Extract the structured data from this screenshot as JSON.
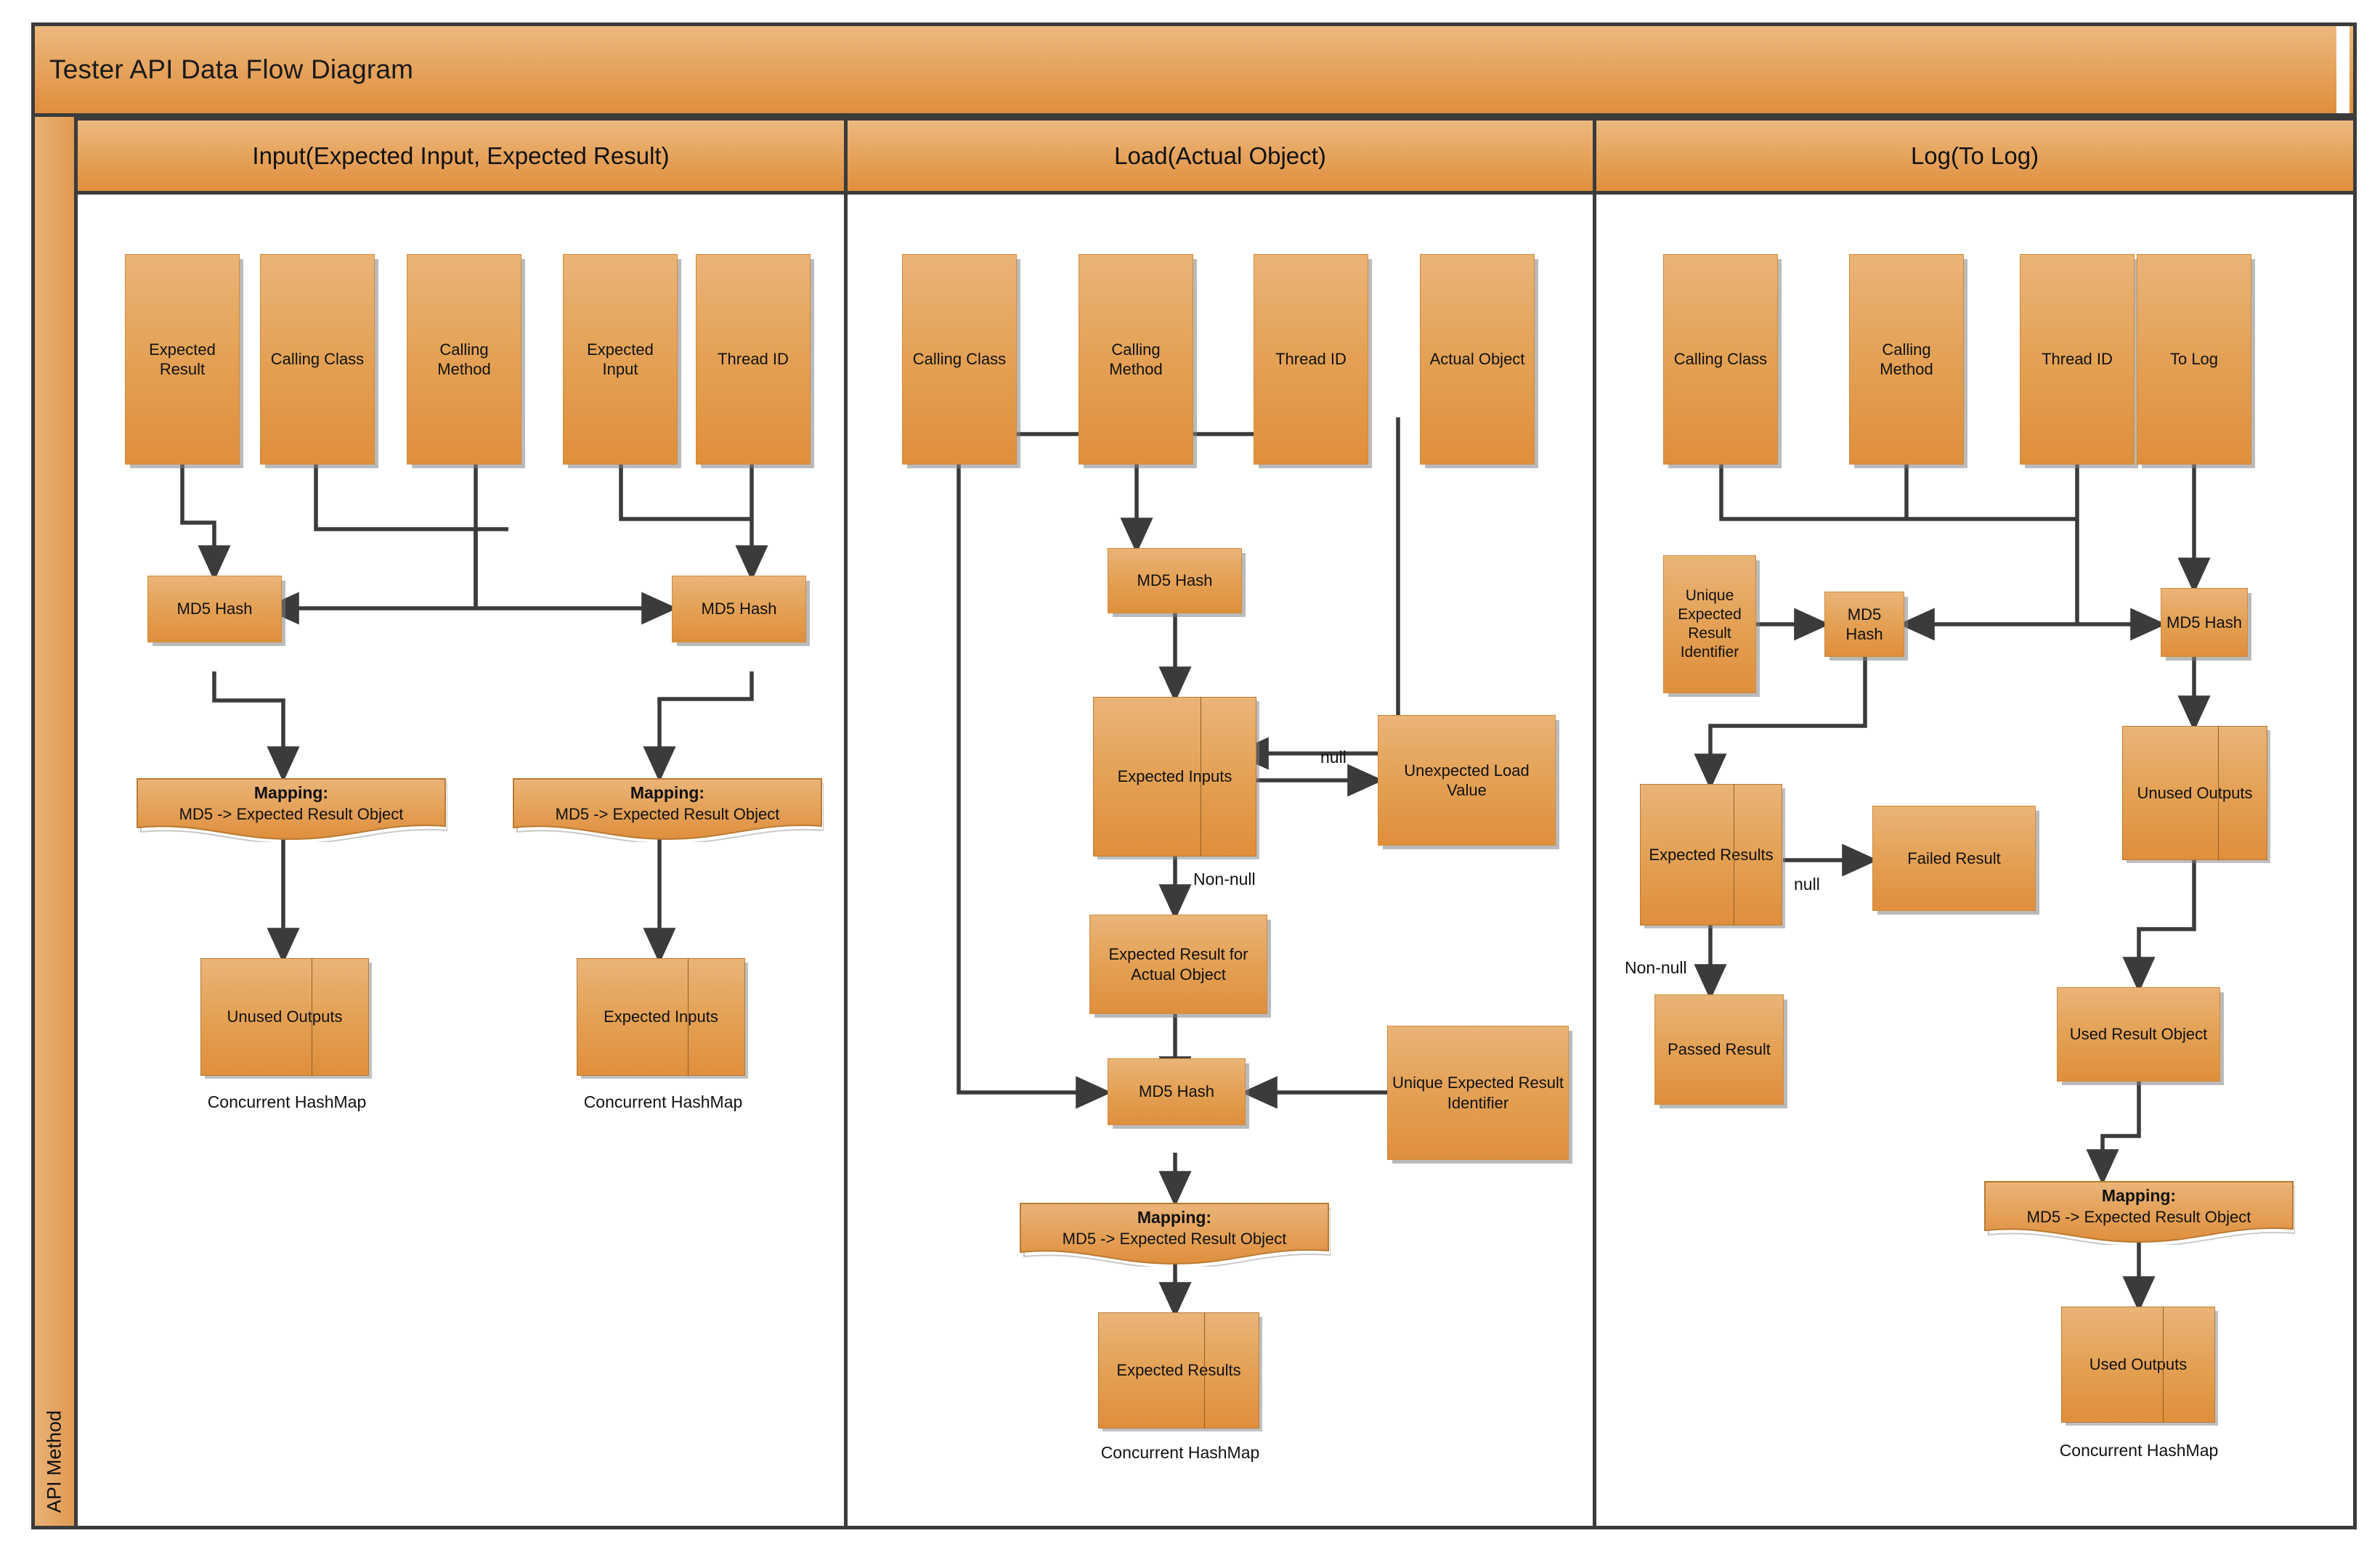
{
  "title": "Tester API Data Flow Diagram",
  "lane_label": "API Method",
  "columns": [
    {
      "header": "Input(Expected Input, Expected Result)",
      "inputs": [
        "Expected Result",
        "Calling Class",
        "Calling Method",
        "Expected Input",
        "Thread ID"
      ],
      "hash_left": "MD5 Hash",
      "hash_right": "MD5 Hash",
      "mapping_left": {
        "title": "Mapping:",
        "body": "MD5 -> Expected Result Object"
      },
      "mapping_right": {
        "title": "Mapping:",
        "body": "MD5 -> Expected Result Object"
      },
      "store_left": "Unused Outputs",
      "store_right": "Expected Inputs",
      "store_left_caption": "Concurrent HashMap",
      "store_right_caption": "Concurrent HashMap"
    },
    {
      "header": "Load(Actual Object)",
      "inputs": [
        "Calling Class",
        "Calling Method",
        "Thread ID",
        "Actual Object"
      ],
      "hash_top": "MD5 Hash",
      "store_expected_inputs": "Expected Inputs",
      "unexpected_load": "Unexpected Load Value",
      "expected_result_actual": "Expected Result for Actual Object",
      "hash_bottom": "MD5 Hash",
      "unique_id": "Unique Expected Result Identifier",
      "mapping": {
        "title": "Mapping:",
        "body": "MD5 -> Expected Result Object"
      },
      "store_expected_results": "Expected Results",
      "store_caption": "Concurrent HashMap",
      "label_null": "null",
      "label_nonnull": "Non-null"
    },
    {
      "header": "Log(To Log)",
      "inputs": [
        "Calling Class",
        "Calling Method",
        "Thread ID",
        "To Log"
      ],
      "unique_id": "Unique Expected Result Identifier",
      "hash_left": "MD5 Hash",
      "hash_right": "MD5 Hash",
      "store_expected_results": "Expected Results",
      "failed_result": "Failed Result",
      "passed_result": "Passed Result",
      "store_unused_outputs": "Unused Outputs",
      "used_result_object": "Used Result Object",
      "mapping": {
        "title": "Mapping:",
        "body": "MD5 -> Expected Result Object"
      },
      "store_used_outputs": "Used Outputs",
      "store_caption": "Concurrent HashMap",
      "label_null": "null",
      "label_nonnull": "Non-null"
    }
  ],
  "colors": {
    "fill_top": "#eab478",
    "fill_bottom": "#df8f3c",
    "border": "#3b3b3b",
    "connector": "#3b3b3b"
  }
}
